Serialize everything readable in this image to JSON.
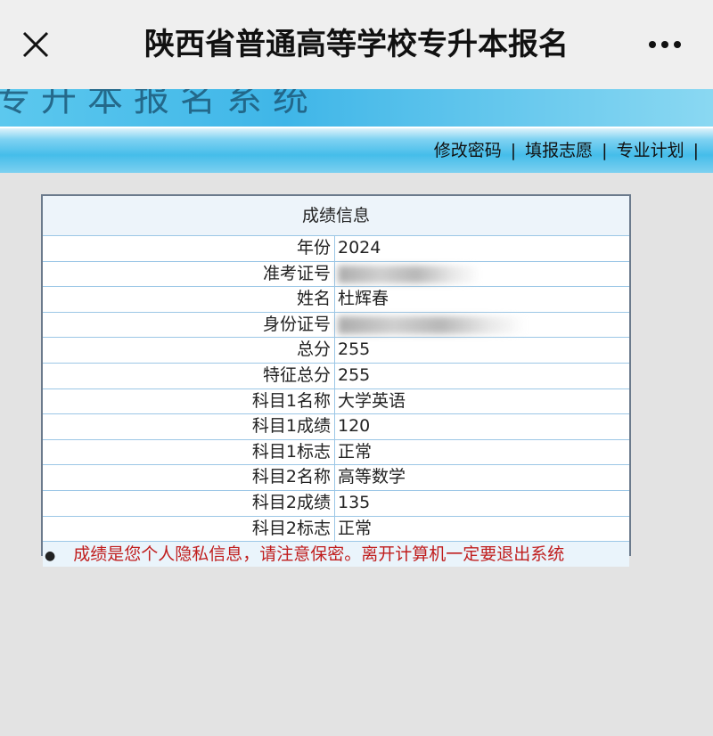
{
  "header": {
    "title": "陕西省普通高等学校专升本报名"
  },
  "banner": {
    "partial_text": "专升本报名系统"
  },
  "nav": {
    "links": [
      "修改密码",
      "填报志愿",
      "专业计划"
    ],
    "separator": "|"
  },
  "panel": {
    "title": "成绩信息",
    "rows": [
      {
        "label": "年份",
        "value": "2024"
      },
      {
        "label": "准考证号",
        "value": ""
      },
      {
        "label": "姓名",
        "value": "杜辉春"
      },
      {
        "label": "身份证号",
        "value": ""
      },
      {
        "label": "总分",
        "value": "255"
      },
      {
        "label": "特征总分",
        "value": "255"
      },
      {
        "label": "科目1名称",
        "value": "大学英语"
      },
      {
        "label": "科目1成绩",
        "value": "120"
      },
      {
        "label": "科目1标志",
        "value": "正常"
      },
      {
        "label": "科目2名称",
        "value": "高等数学"
      },
      {
        "label": "科目2成绩",
        "value": "135"
      },
      {
        "label": "科目2标志",
        "value": "正常"
      }
    ],
    "notice": "成绩是您个人隐私信息，请注意保密。离开计算机一定要退出系统"
  },
  "icons": {
    "close": "close-icon",
    "more": "more-icon"
  }
}
